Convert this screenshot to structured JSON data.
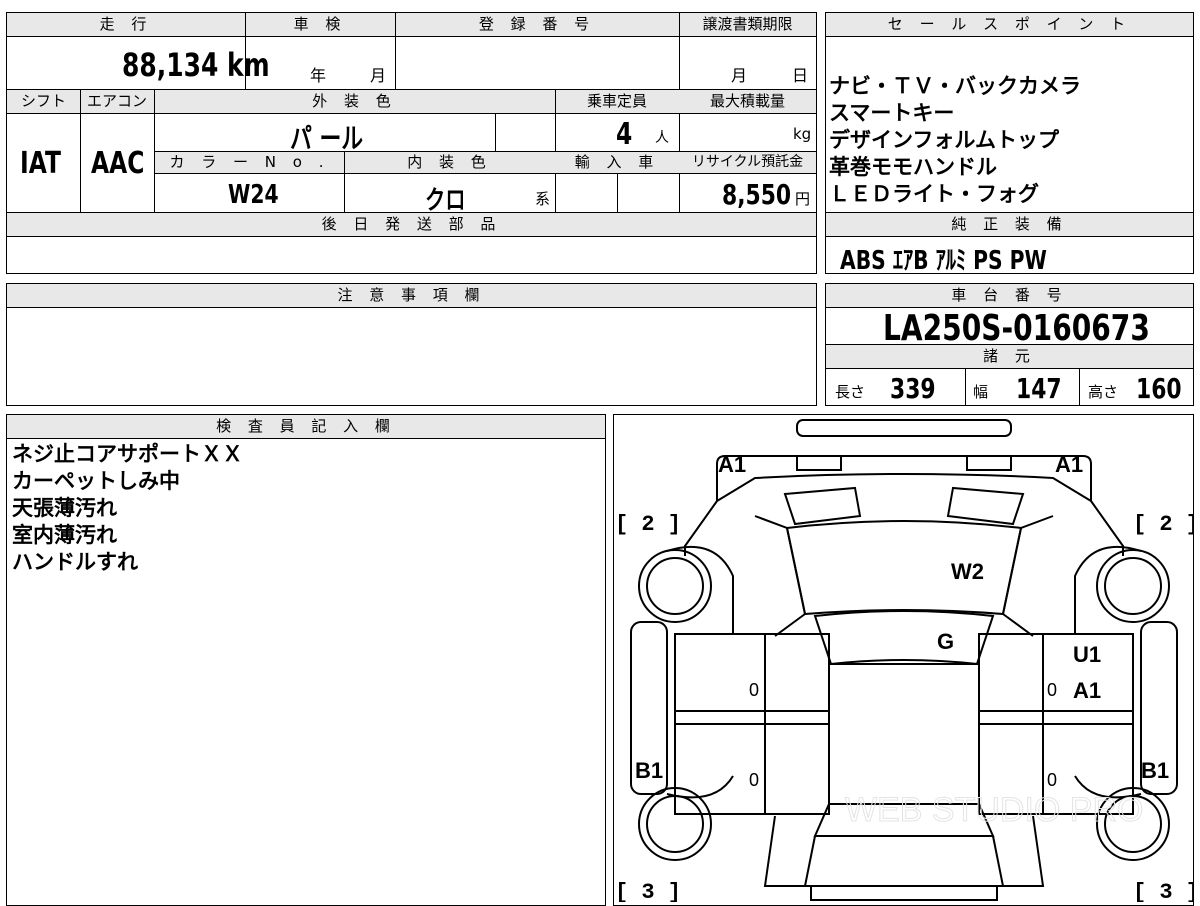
{
  "top_left": {
    "mileage_label": "走 行",
    "mileage_value": "88,134 km",
    "inspection_label": "車 検",
    "inspection_year": "年",
    "inspection_month": "月",
    "registration_label": "登 録 番 号",
    "transfer_label": "譲渡書類期限",
    "transfer_month": "月",
    "transfer_day": "日",
    "shift_label": "シフト",
    "shift_value": "IAT",
    "ac_label": "エアコン",
    "ac_value": "AAC",
    "exterior_label": "外 装 色",
    "exterior_value": "パ ール",
    "capacity_label": "乗車定員",
    "capacity_value": "4",
    "capacity_unit": "人",
    "max_load_label": "最大積載量",
    "max_load_unit": "kg",
    "color_no_label": "カ ラ ー N o .",
    "color_no_value": "W24",
    "interior_label": "内 装 色",
    "interior_value": "クロ",
    "interior_suffix": "系",
    "import_label": "輸 入 車",
    "recycle_label": "リサイクル預託金",
    "recycle_value": "8,550",
    "recycle_unit": "円",
    "later_parts_label": "後 日 発 送 部 品"
  },
  "sales": {
    "label": "セ ー ル ス ポ イ ン ト",
    "points": [
      "ナビ・ＴＶ・バックカメラ",
      "スマートキー",
      "デザインフォルムトップ",
      "革巻モモハンドル",
      "ＬＥＤライト・フォグ"
    ]
  },
  "equipment": {
    "label": "純 正 装 備",
    "value": "ABS ｴｱB ｱﾙﾐ PS PW"
  },
  "notes": {
    "label": "注 意 事 項 欄"
  },
  "chassis": {
    "label": "車 台 番 号",
    "value": "LA250S-0160673"
  },
  "specs": {
    "label": "諸 元",
    "length_label": "長さ",
    "length_value": "339",
    "width_label": "幅",
    "width_value": "147",
    "height_label": "高さ",
    "height_value": "160"
  },
  "inspector": {
    "label": "検 査 員 記 入 欄",
    "lines": [
      "ネジ止コアサポートＸＸ",
      "カーペットしみ中",
      "天張薄汚れ",
      "室内薄汚れ",
      "ハンドルすれ"
    ]
  },
  "diagram": {
    "marks": {
      "a1_left": "A1",
      "a1_right": "A1",
      "w2": "W2",
      "g": "G",
      "u1": "U1",
      "a1_side": "A1",
      "b1_left": "B1",
      "b1_right": "B1",
      "zero_1": "0",
      "zero_2": "0",
      "zero_3": "0",
      "zero_4": "0",
      "tyre_fl": "[ 2 ]",
      "tyre_fr": "[ 2 ]",
      "tyre_rl": "[ 3 ]",
      "tyre_rr": "[ 3 ]"
    },
    "watermark": "WEB STUDIO PRO"
  }
}
